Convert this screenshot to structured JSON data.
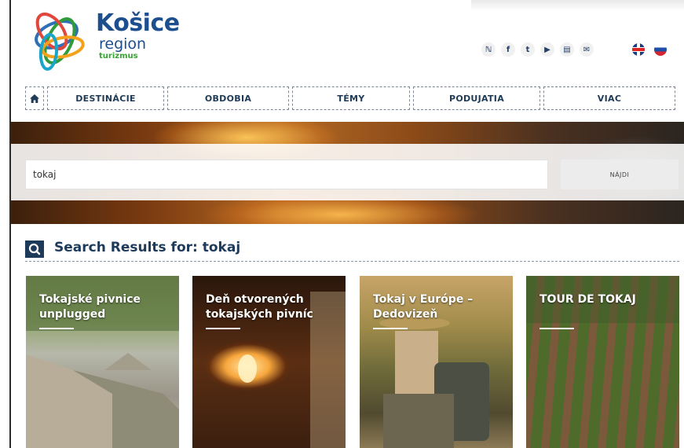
{
  "brand": {
    "line1": "Košice",
    "line2": "region",
    "line3": "turizmus"
  },
  "social": {
    "items": [
      {
        "name": "rss-icon",
        "glyph": "ℕ"
      },
      {
        "name": "facebook-icon",
        "glyph": "f"
      },
      {
        "name": "twitter-icon",
        "glyph": "t"
      },
      {
        "name": "youtube-icon",
        "glyph": "▶"
      },
      {
        "name": "document-icon",
        "glyph": "▤"
      },
      {
        "name": "mail-icon",
        "glyph": "✉"
      }
    ]
  },
  "languages": [
    {
      "code": "en",
      "name": "english-flag-icon"
    },
    {
      "code": "sk",
      "name": "slovak-flag-icon"
    }
  ],
  "nav": {
    "home_icon": "home-icon",
    "items": [
      "DESTINÁCIE",
      "OBDOBIA",
      "TÉMY",
      "PODUJATIA",
      "VIAC"
    ]
  },
  "search": {
    "value": "tokaj",
    "button_label": "NÁJDI"
  },
  "results": {
    "heading": "Search Results for: tokaj",
    "icon": "search-icon",
    "cards": [
      {
        "title": "Tokajské pivnice unplugged"
      },
      {
        "title": "Deň otvorených tokajských pivníc"
      },
      {
        "title": "Tokaj v Európe – Dedovizeň"
      },
      {
        "title": "TOUR DE TOKAJ"
      }
    ]
  },
  "colors": {
    "brand_blue": "#1d4f8e",
    "brand_green": "#3aa335",
    "heading_navy": "#1d3a5a"
  }
}
